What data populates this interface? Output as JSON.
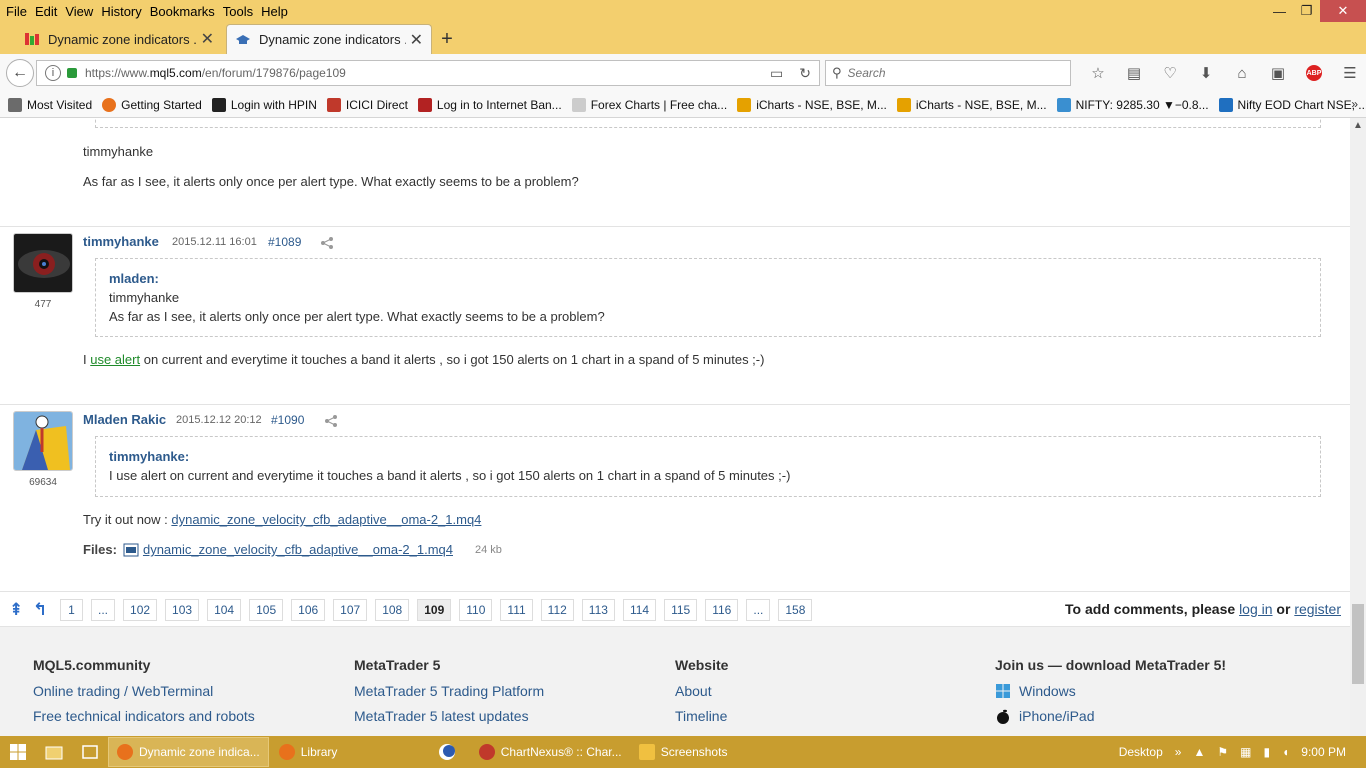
{
  "menubar": {
    "items": [
      "File",
      "Edit",
      "View",
      "History",
      "Bookmarks",
      "Tools",
      "Help"
    ],
    "minimize": "—",
    "restore": "❐",
    "close": "✕"
  },
  "tabs": [
    {
      "label": "Dynamic zone indicators ....",
      "close": "✕"
    },
    {
      "label": "Dynamic zone indicators ....",
      "close": "✕"
    }
  ],
  "newtab": "+",
  "nav": {
    "url_prefix": "https://www.",
    "url_domain": "mql5.com",
    "url_path": "/en/forum/179876/page109",
    "search_placeholder": "Search"
  },
  "bookmarks": [
    {
      "label": "Most Visited",
      "color": "#6b6b6b"
    },
    {
      "label": "Getting Started",
      "color": "#e8711c"
    },
    {
      "label": "Login with HPIN",
      "color": "#222222"
    },
    {
      "label": "ICICI Direct",
      "color": "#c0392b"
    },
    {
      "label": "Log in to Internet Ban...",
      "color": "#b22222"
    },
    {
      "label": "Forex Charts | Free cha...",
      "color": "#cccccc"
    },
    {
      "label": "iCharts - NSE, BSE, M...",
      "color": "#e5a100"
    },
    {
      "label": "iCharts - NSE, BSE, M...",
      "color": "#e5a100"
    },
    {
      "label": "NIFTY: 9285.30 ▼−0.8...",
      "color": "#3a8fd0"
    },
    {
      "label": "Nifty EOD Chart NSE, ...",
      "color": "#1f6fc0"
    }
  ],
  "bookmarks_more": "»",
  "prev_post": {
    "quoted_author": "timmyhanke",
    "text": "As far as I see, it alerts only once per alert type. What exactly seems to be a problem?"
  },
  "posts": [
    {
      "author": "timmyhanke",
      "date": "2015.12.11 16:01",
      "number": "#1089",
      "rating": "477",
      "quote_author": "mladen:",
      "quote_lines": [
        "timmyhanke",
        "As far as I see, it alerts only once per alert type. What exactly seems to be a problem?"
      ],
      "body_prefix": "I ",
      "body_link": "use alert",
      "body_suffix": " on current and everytime it touches a band it alerts , so i got 150 alerts on 1 chart in a spand of 5 minutes ;-)"
    },
    {
      "author": "Mladen Rakic",
      "date": "2015.12.12 20:12",
      "number": "#1090",
      "rating": "69634",
      "quote_author": "timmyhanke:",
      "quote_lines": [
        "I use alert on current and everytime it touches a band it alerts , so i got 150 alerts on 1 chart in a spand of 5 minutes ;-)"
      ],
      "body_prefix": "Try it out now : ",
      "body_link": "dynamic_zone_velocity_cfb_adaptive__oma-2_1.mq4",
      "files_label": "Files:",
      "file_name": "dynamic_zone_velocity_cfb_adaptive__oma-2_1.mq4",
      "file_size": "24 kb"
    }
  ],
  "pager": {
    "pages": [
      "1",
      "...",
      "102",
      "103",
      "104",
      "105",
      "106",
      "107",
      "108",
      "109",
      "110",
      "111",
      "112",
      "113",
      "114",
      "115",
      "116",
      "...",
      "158"
    ],
    "current": "109",
    "login_prefix": "To add comments, please ",
    "login_link": "log in",
    "login_or": " or ",
    "register_link": "register"
  },
  "footer": {
    "col1": {
      "heading": "MQL5.community",
      "links": [
        "Online trading / WebTerminal",
        "Free technical indicators and robots"
      ]
    },
    "col2": {
      "heading": "MetaTrader 5",
      "links": [
        "MetaTrader 5 Trading Platform",
        "MetaTrader 5 latest updates"
      ]
    },
    "col3": {
      "heading": "Website",
      "links": [
        "About",
        "Timeline"
      ]
    },
    "col4": {
      "heading": "Join us — download MetaTrader 5!",
      "links": [
        "Windows",
        "iPhone/iPad"
      ]
    }
  },
  "taskbar": {
    "items": [
      {
        "label": "Dynamic zone indica...",
        "color": "#e8711c"
      },
      {
        "label": "Library",
        "color": "#e8711c"
      },
      {
        "label": "ChartNexus® :: Char...",
        "color": "#c0392b"
      },
      {
        "label": "Screenshots",
        "color": "#f0c040"
      }
    ],
    "desktop": "Desktop",
    "chevron": "»",
    "time": "9:00 PM"
  }
}
